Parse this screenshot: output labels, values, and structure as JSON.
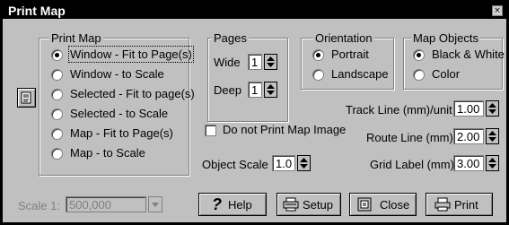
{
  "window": {
    "title": "Print Map"
  },
  "print_map": {
    "label": "Print Map",
    "options": [
      {
        "label": "Window - Fit to Page(s)",
        "selected": true
      },
      {
        "label": "Window - to Scale",
        "selected": false
      },
      {
        "label": "Selected - Fit to page(s)",
        "selected": false
      },
      {
        "label": "Selected - to Scale",
        "selected": false
      },
      {
        "label": "Map - Fit to Page(s)",
        "selected": false
      },
      {
        "label": "Map - to Scale",
        "selected": false
      }
    ]
  },
  "pages": {
    "label": "Pages",
    "wide_label": "Wide",
    "wide_value": "1",
    "deep_label": "Deep",
    "deep_value": "1"
  },
  "orientation": {
    "label": "Orientation",
    "options": [
      {
        "label": "Portrait",
        "selected": true
      },
      {
        "label": "Landscape",
        "selected": false
      }
    ]
  },
  "map_objects": {
    "label": "Map Objects",
    "options": [
      {
        "label": "Black & White",
        "selected": true
      },
      {
        "label": "Color",
        "selected": false
      }
    ]
  },
  "settings": {
    "track_line_label": "Track Line (mm)/unit",
    "track_line_value": "1.00",
    "route_line_label": "Route Line (mm)",
    "route_line_value": "2.00",
    "grid_label_label": "Grid Label (mm)",
    "grid_label_value": "3.00",
    "object_scale_label": "Object Scale",
    "object_scale_value": "1.0",
    "no_print_image_label": "Do not Print Map Image"
  },
  "scale": {
    "label": "Scale 1:",
    "value": "500,000"
  },
  "buttons": {
    "help": "Help",
    "setup": "Setup",
    "close": "Close",
    "print": "Print"
  },
  "icons": {
    "preview": "page-preview-icon",
    "help": "question-mark-icon",
    "setup": "printer-setup-icon",
    "close": "close-door-icon",
    "print": "printer-icon",
    "window_close": "close-icon"
  }
}
